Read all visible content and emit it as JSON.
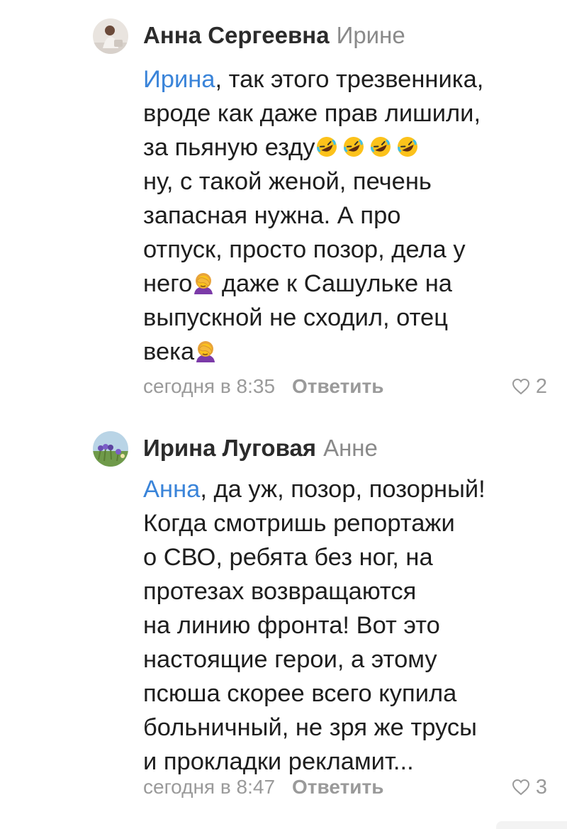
{
  "comments": [
    {
      "author": "Анна Сергеевна",
      "reply_to": "Ирине",
      "avatar_icon": "person-photo-avatar",
      "lines": [
        {
          "mention": "Ирина",
          "text": ", так этого трезвенника,"
        },
        {
          "text": "вроде как даже прав лишили,"
        },
        {
          "text": "за пьяную езду",
          "emoji": [
            "rolling-on-floor-laughing-emoji",
            "rolling-on-floor-laughing-emoji",
            "rolling-on-floor-laughing-emoji",
            "rolling-on-floor-laughing-emoji"
          ]
        },
        {
          "text": "ну, с такой женой, печень"
        },
        {
          "text": "запасная нужна. А про"
        },
        {
          "text": "отпуск, просто позор, дела у"
        },
        {
          "text_before": "него",
          "emoji": [
            "facepalm-emoji"
          ],
          "text": " даже к Сашульке на"
        },
        {
          "text": "выпускной не сходил, отец"
        },
        {
          "text": "века",
          "emoji": [
            "facepalm-emoji"
          ]
        }
      ],
      "time": "сегодня в 8:35",
      "reply_label": "Ответить",
      "likes": "2"
    },
    {
      "author": "Ирина Луговая",
      "reply_to": "Анне",
      "avatar_icon": "flowers-landscape-avatar",
      "lines": [
        {
          "mention": "Анна",
          "text": ", да уж, позор, позорный!"
        },
        {
          "text": "Когда смотришь репортажи"
        },
        {
          "text": "о СВО, ребята без ног, на"
        },
        {
          "text": "протезах возвращаются"
        },
        {
          "text": "на линию фронта! Вот это"
        },
        {
          "text": "настоящие герои, а этому"
        },
        {
          "text": "псюша скорее всего купила"
        },
        {
          "text": "больничный, не зря же трусы"
        },
        {
          "text": "и прокладки рекламит..."
        }
      ],
      "time": "сегодня в 8:47",
      "reply_label": "Ответить",
      "likes": "3"
    }
  ],
  "colors": {
    "mention": "#3a84d9",
    "meta": "#9a9a9a",
    "text": "#1e1e1e"
  }
}
